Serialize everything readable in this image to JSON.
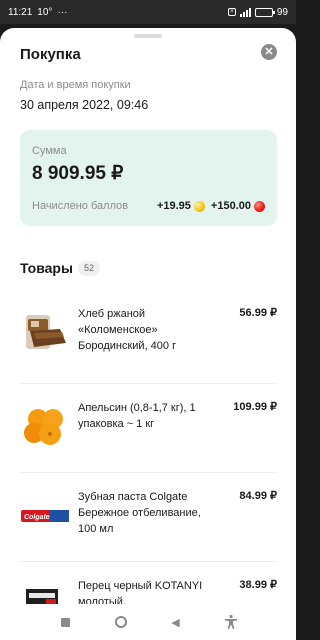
{
  "status_bar": {
    "time": "11:21",
    "temperature": "10°",
    "more": "···",
    "battery": "99",
    "battery_level": 0.99
  },
  "sheet": {
    "title": "Покупка",
    "date_label": "Дата и время покупки",
    "date_value": "30 апреля 2022, 09:46"
  },
  "summary": {
    "sum_label": "Сумма",
    "sum_value": "8 909.95 ₽",
    "points_label": "Начислено баллов",
    "points_yellow": "+19.95",
    "points_red": "+150.00"
  },
  "goods": {
    "title": "Товары",
    "count": "52",
    "items": [
      {
        "name": "Хлеб ржаной «Коломенское» Бородинский, 400 г",
        "price": "56.99 ₽",
        "icon": "bread"
      },
      {
        "name": "Апельсин (0,8-1,7 кг), 1 упаковка ~ 1 кг",
        "price": "109.99 ₽",
        "icon": "oranges"
      },
      {
        "name": "Зубная паста Colgate Бережное отбеливание, 100 мл",
        "price": "84.99 ₽",
        "icon": "toothpaste"
      },
      {
        "name": "Перец черный KOTANYI молотый,",
        "price": "38.99 ₽",
        "icon": "pepper"
      }
    ]
  },
  "product_labels": {
    "colgate": "Colgate"
  },
  "colors": {
    "card_bg": "#e3f4ee",
    "coin_yellow": "#f4c20d",
    "coin_red": "#e21b1b"
  }
}
